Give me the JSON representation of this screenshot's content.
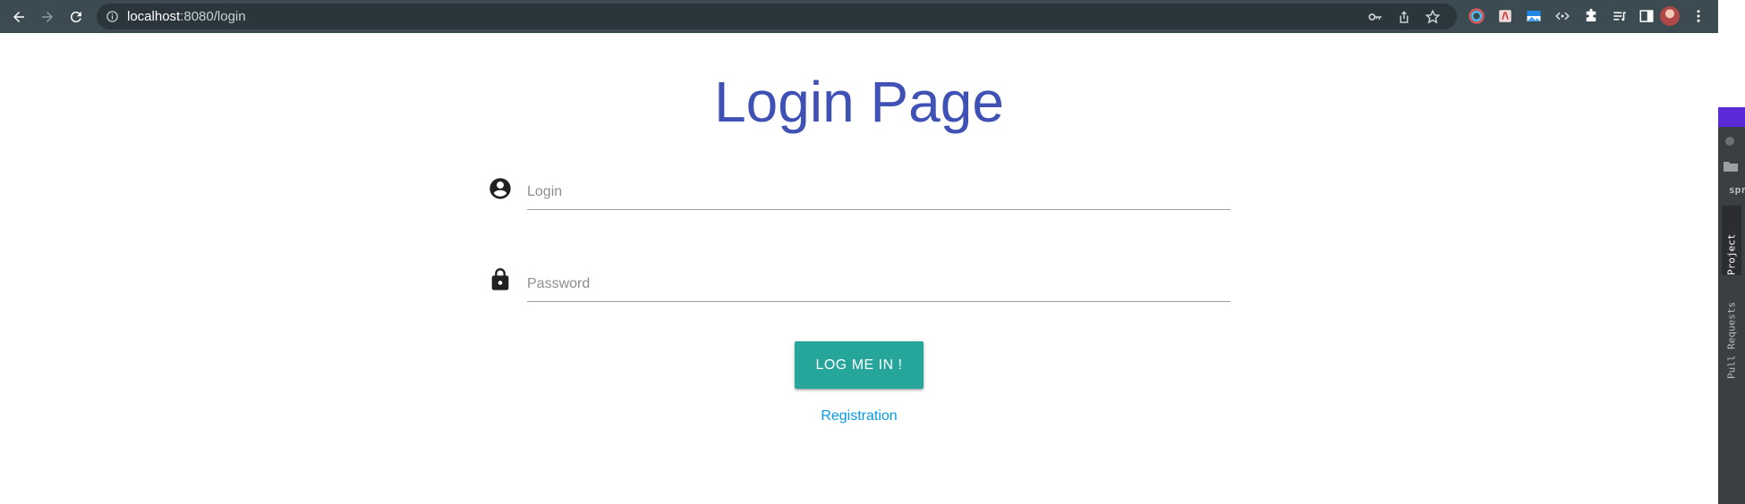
{
  "browser": {
    "url_host": "localhost",
    "url_path": ":8080/login"
  },
  "page": {
    "title": "Login Page",
    "login_placeholder": "Login",
    "password_placeholder": "Password",
    "submit_label": "LOG ME IN !",
    "registration_link": "Registration"
  },
  "ide": {
    "partial_text": "spr",
    "project_tab": "Project",
    "pull_requests_tab": "Pull Requests"
  },
  "colors": {
    "title": "#3f51b5",
    "button": "#26a69a",
    "link": "#039be5",
    "toolbar": "#3c4a52"
  },
  "icons": {
    "back": "arrow-left-icon",
    "forward": "arrow-right-icon",
    "reload": "reload-icon",
    "site_info": "info-icon",
    "key": "key-icon",
    "share": "share-icon",
    "bookmark": "star-icon",
    "extensions": "puzzle-icon",
    "login_field": "account-circle-icon",
    "password_field": "lock-icon"
  }
}
